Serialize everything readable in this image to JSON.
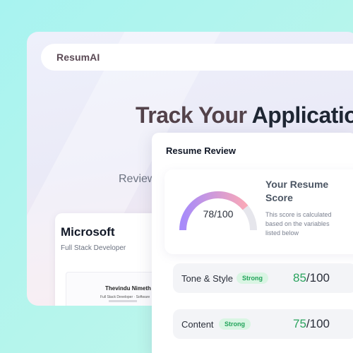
{
  "nav": {
    "brand": "ResumAI"
  },
  "hero": {
    "title_first": "Track Your ",
    "title_rest": "Applicatio",
    "subtitle": "Review"
  },
  "job_card": {
    "company": "Microsoft",
    "role": "Full Stack Developer",
    "resume": {
      "name": "Thevindu Nimeth",
      "headline": "Full Stack Developer · Software"
    }
  },
  "review": {
    "title": "Resume Review",
    "score": {
      "value_text": "78/100",
      "value": 78,
      "max": 100,
      "heading": "Your Resume Score",
      "description": "This score is calculated based on the variables listed below",
      "gradient_from": "#a78bfa",
      "gradient_to": "#f9a8b8",
      "track_color": "#e6e6ec"
    },
    "metrics": [
      {
        "label": "Tone & Style",
        "badge": "Strong",
        "score": "85",
        "max": "/100"
      },
      {
        "label": "Content",
        "badge": "Strong",
        "score": "75",
        "max": "/100"
      }
    ]
  },
  "colors": {
    "accent_green": "#2aa35e",
    "badge_bg": "#d9f5e3",
    "background": "#a8f3f0"
  }
}
